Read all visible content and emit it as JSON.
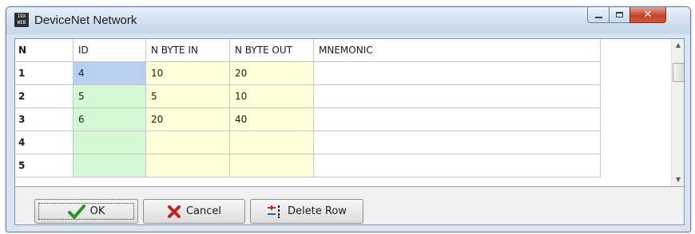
{
  "window": {
    "title": "DeviceNet Network",
    "icon_text": "IDX WEB"
  },
  "grid": {
    "columns": [
      "N",
      "ID",
      "N BYTE IN",
      "N BYTE OUT",
      "MNEMONIC"
    ],
    "rows": [
      {
        "n": "1",
        "id": "4",
        "byte_in": "10",
        "byte_out": "20",
        "mnemonic": ""
      },
      {
        "n": "2",
        "id": "5",
        "byte_in": "5",
        "byte_out": "10",
        "mnemonic": ""
      },
      {
        "n": "3",
        "id": "6",
        "byte_in": "20",
        "byte_out": "40",
        "mnemonic": ""
      },
      {
        "n": "4",
        "id": "",
        "byte_in": "",
        "byte_out": "",
        "mnemonic": ""
      },
      {
        "n": "5",
        "id": "",
        "byte_in": "",
        "byte_out": "",
        "mnemonic": ""
      }
    ]
  },
  "buttons": {
    "ok": "OK",
    "cancel": "Cancel",
    "delete_row": "Delete Row"
  },
  "icons": {
    "ok": "check-icon",
    "cancel": "x-icon",
    "delete_row": "delete-row-icon",
    "minimize": "minimize-icon",
    "maximize": "maximize-icon",
    "close": "close-icon"
  },
  "colors": {
    "id_column": "#d4f7d4",
    "id_selected": "#b9cfee",
    "byte_columns": "#ffffd9",
    "close_button": "#c8412b"
  }
}
